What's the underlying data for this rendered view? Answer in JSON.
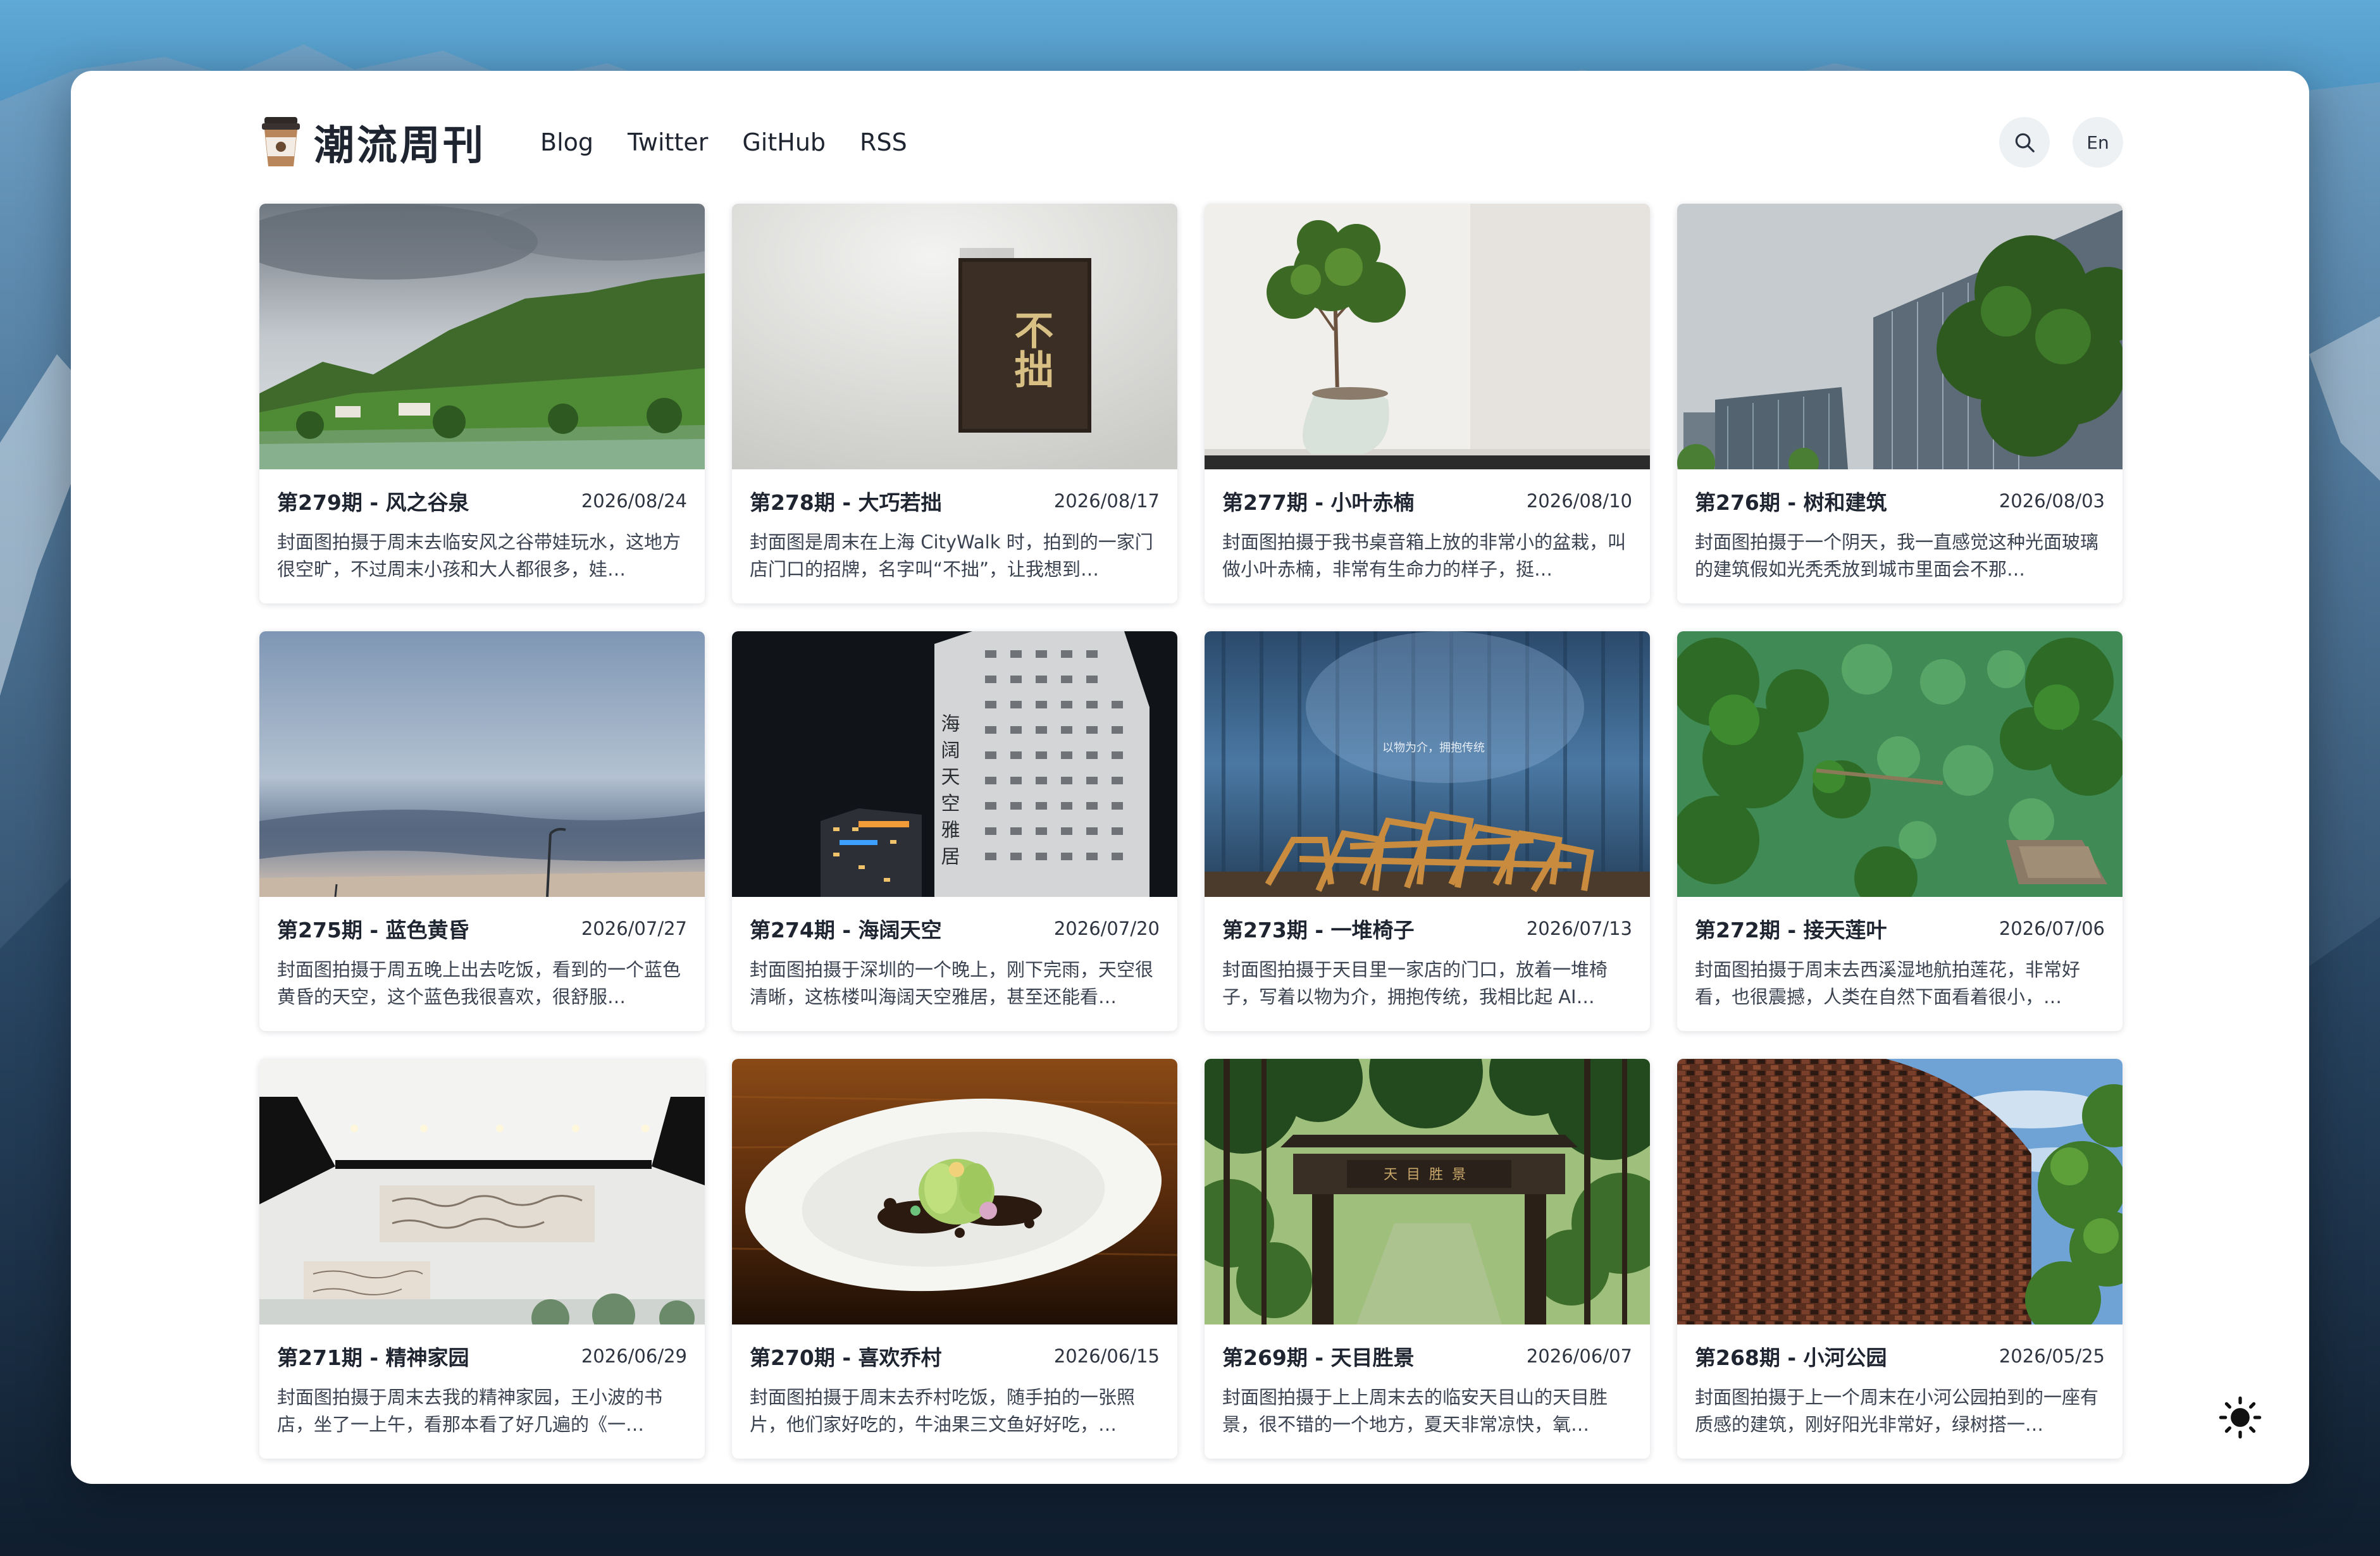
{
  "header": {
    "brand": "潮流周刊",
    "nav": [
      {
        "label": "Blog"
      },
      {
        "label": "Twitter"
      },
      {
        "label": "GitHub"
      },
      {
        "label": "RSS"
      }
    ],
    "lang_label": "En",
    "search_icon": "search-icon"
  },
  "cards": [
    {
      "title": "第279期 - 风之谷泉",
      "date": "2026/08/24",
      "desc": "封面图拍摄于周末去临安风之谷带娃玩水，这地方很空旷，不过周末小孩和大人都很多，娃…"
    },
    {
      "title": "第278期 - 大巧若拙",
      "date": "2026/08/17",
      "desc": "封面图是周末在上海 CityWalk 时，拍到的一家门店门口的招牌，名字叫“不拙”，让我想到…"
    },
    {
      "title": "第277期 - 小叶赤楠",
      "date": "2026/08/10",
      "desc": "封面图拍摄于我书桌音箱上放的非常小的盆栽，叫做小叶赤楠，非常有生命力的样子，挺…"
    },
    {
      "title": "第276期 - 树和建筑",
      "date": "2026/08/03",
      "desc": "封面图拍摄于一个阴天，我一直感觉这种光面玻璃的建筑假如光秃秃放到城市里面会不那…"
    },
    {
      "title": "第275期 - 蓝色黄昏",
      "date": "2026/07/27",
      "desc": "封面图拍摄于周五晚上出去吃饭，看到的一个蓝色黄昏的天空，这个蓝色我很喜欢，很舒服…"
    },
    {
      "title": "第274期 - 海阔天空",
      "date": "2026/07/20",
      "desc": "封面图拍摄于深圳的一个晚上，刚下完雨，天空很清晰，这栋楼叫海阔天空雅居，甚至还能看…"
    },
    {
      "title": "第273期 - 一堆椅子",
      "date": "2026/07/13",
      "desc": "封面图拍摄于天目里一家店的门口，放着一堆椅子，写着以物为介，拥抱传统，我相比起 AI…"
    },
    {
      "title": "第272期 - 接天莲叶",
      "date": "2026/07/06",
      "desc": "封面图拍摄于周末去西溪湿地航拍莲花，非常好看，也很震撼，人类在自然下面看着很小，…"
    },
    {
      "title": "第271期 - 精神家园",
      "date": "2026/06/29",
      "desc": "封面图拍摄于周末去我的精神家园，王小波的书店，坐了一上午，看那本看了好几遍的《一…"
    },
    {
      "title": "第270期 - 喜欢乔村",
      "date": "2026/06/15",
      "desc": "封面图拍摄于周末去乔村吃饭，随手拍的一张照片，他们家好吃的，牛油果三文鱼好好吃，…"
    },
    {
      "title": "第269期 - 天目胜景",
      "date": "2026/06/07",
      "desc": "封面图拍摄于上上周末去的临安天目山的天目胜景，很不错的一个地方，夏天非常凉快，氧…"
    },
    {
      "title": "第268期 - 小河公园",
      "date": "2026/05/25",
      "desc": "封面图拍摄于上一个周末在小河公园拍到的一座有质感的建筑，刚好阳光非常好，绿树搭一…"
    }
  ],
  "image_texts": {
    "sign": "不拙",
    "building": "海阔天空雅居",
    "wall": "以物为介，拥抱传统",
    "gate": "天目胜景"
  }
}
